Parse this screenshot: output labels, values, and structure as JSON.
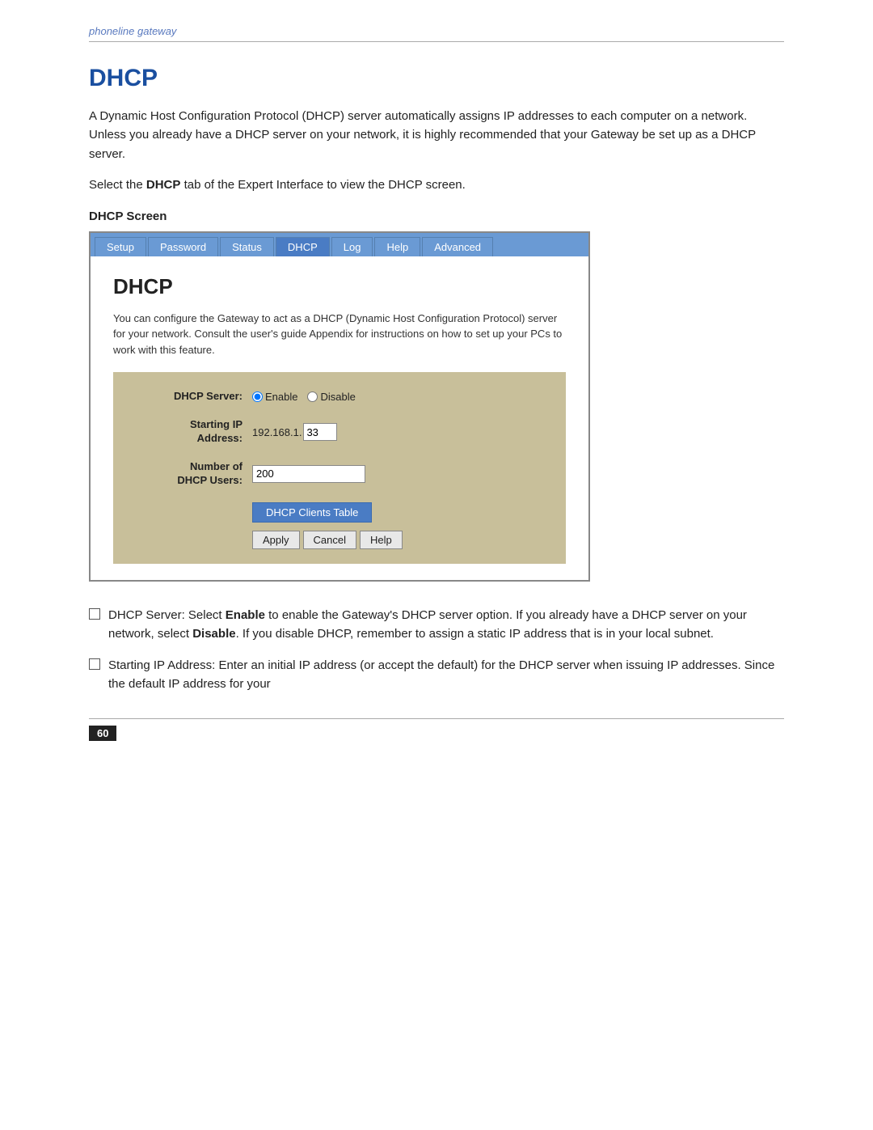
{
  "header": {
    "brand": "phoneline gateway"
  },
  "page": {
    "title": "DHCP",
    "intro": "A Dynamic Host Configuration Protocol (DHCP) server automatically assigns IP addresses to each computer on a network. Unless you already have a DHCP server on your network, it is highly recommended that your Gateway be set up as a DHCP server.",
    "select_text_prefix": "Select the ",
    "select_text_bold": "DHCP",
    "select_text_suffix": " tab of the Expert Interface to view the DHCP screen.",
    "screen_label": "DHCP Screen"
  },
  "nav": {
    "tabs": [
      {
        "label": "Setup",
        "active": false
      },
      {
        "label": "Password",
        "active": false
      },
      {
        "label": "Status",
        "active": false
      },
      {
        "label": "DHCP",
        "active": true
      },
      {
        "label": "Log",
        "active": false
      },
      {
        "label": "Help",
        "active": false
      },
      {
        "label": "Advanced",
        "active": false
      }
    ]
  },
  "screen": {
    "title": "DHCP",
    "description": "You can configure the Gateway to act as a DHCP (Dynamic Host Configuration Protocol) server for your network. Consult the user's guide Appendix for instructions on how to set up your PCs to work with this feature.",
    "form": {
      "dhcp_server_label": "DHCP Server:",
      "enable_label": "Enable",
      "disable_label": "Disable",
      "starting_ip_label": "Starting IP Address:",
      "ip_prefix": "192.168.1.",
      "ip_value": "33",
      "num_users_label": "Number of DHCP Users:",
      "num_users_value": "200",
      "clients_table_btn": "DHCP Clients Table",
      "apply_btn": "Apply",
      "cancel_btn": "Cancel",
      "help_btn": "Help"
    }
  },
  "bullets": [
    {
      "text_prefix": "DHCP Server:  Select ",
      "text_bold": "Enable",
      "text_middle": " to enable the Gateway's DHCP server option. If you already have a DHCP server on your network, select ",
      "text_bold2": "Disable",
      "text_suffix": ". If you disable DHCP, remember to assign a static IP address that is in your local subnet."
    },
    {
      "text_prefix": "Starting IP Address:  Enter an initial IP address (or accept the default) for the DHCP server when issuing IP addresses. Since the default IP address for your"
    }
  ],
  "footer": {
    "page_number": "60"
  }
}
